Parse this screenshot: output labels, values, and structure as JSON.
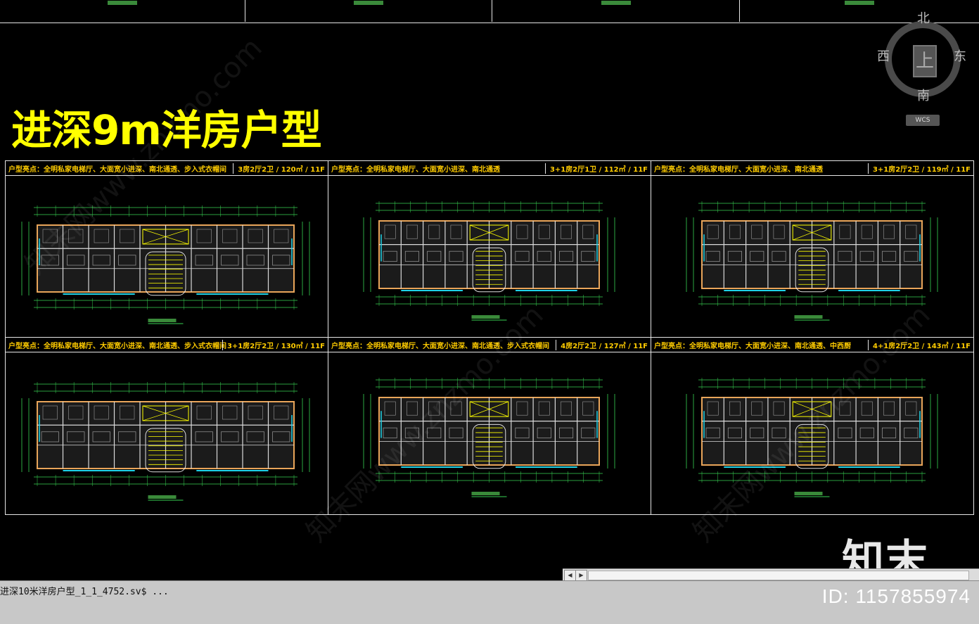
{
  "title": "进深9m洋房户型",
  "compass": {
    "north": "北",
    "south": "南",
    "east": "东",
    "west": "西",
    "center": "上",
    "wcs": "WCS"
  },
  "panels": [
    {
      "highlight": "户型亮点：全明私家电梯厅、大面宽小进深、南北通透、步入式衣帽间",
      "unit": "3房2厅2卫 / 120㎡ / 11F"
    },
    {
      "highlight": "户型亮点：全明私家电梯厅、大面宽小进深、南北通透",
      "unit": "3+1房2厅1卫 / 112㎡ / 11F"
    },
    {
      "highlight": "户型亮点：全明私家电梯厅、大面宽小进深、南北通透",
      "unit": "3+1房2厅2卫 / 119㎡ / 11F"
    },
    {
      "highlight": "户型亮点：全明私家电梯厅、大面宽小进深、南北通透、步入式衣帽间",
      "unit": "3+1房2厅2卫 / 130㎡ / 11F"
    },
    {
      "highlight": "户型亮点：全明私家电梯厅、大面宽小进深、南北通透、步入式衣帽间",
      "unit": "4房2厅2卫 / 127㎡ / 11F"
    },
    {
      "highlight": "户型亮点：全明私家电梯厅、大面宽小进深、南北通透、中西厨",
      "unit": "4+1房2厅2卫 / 143㎡ / 11F"
    }
  ],
  "watermark": "知末网www.znzmo.com",
  "logo": "知末",
  "command_line": "进深10米洋房户型_1_1_4752.sv$ ...",
  "image_id": "ID: 1157855974",
  "scroll": {
    "left_arrow": "◀",
    "right_arrow": "▶"
  }
}
